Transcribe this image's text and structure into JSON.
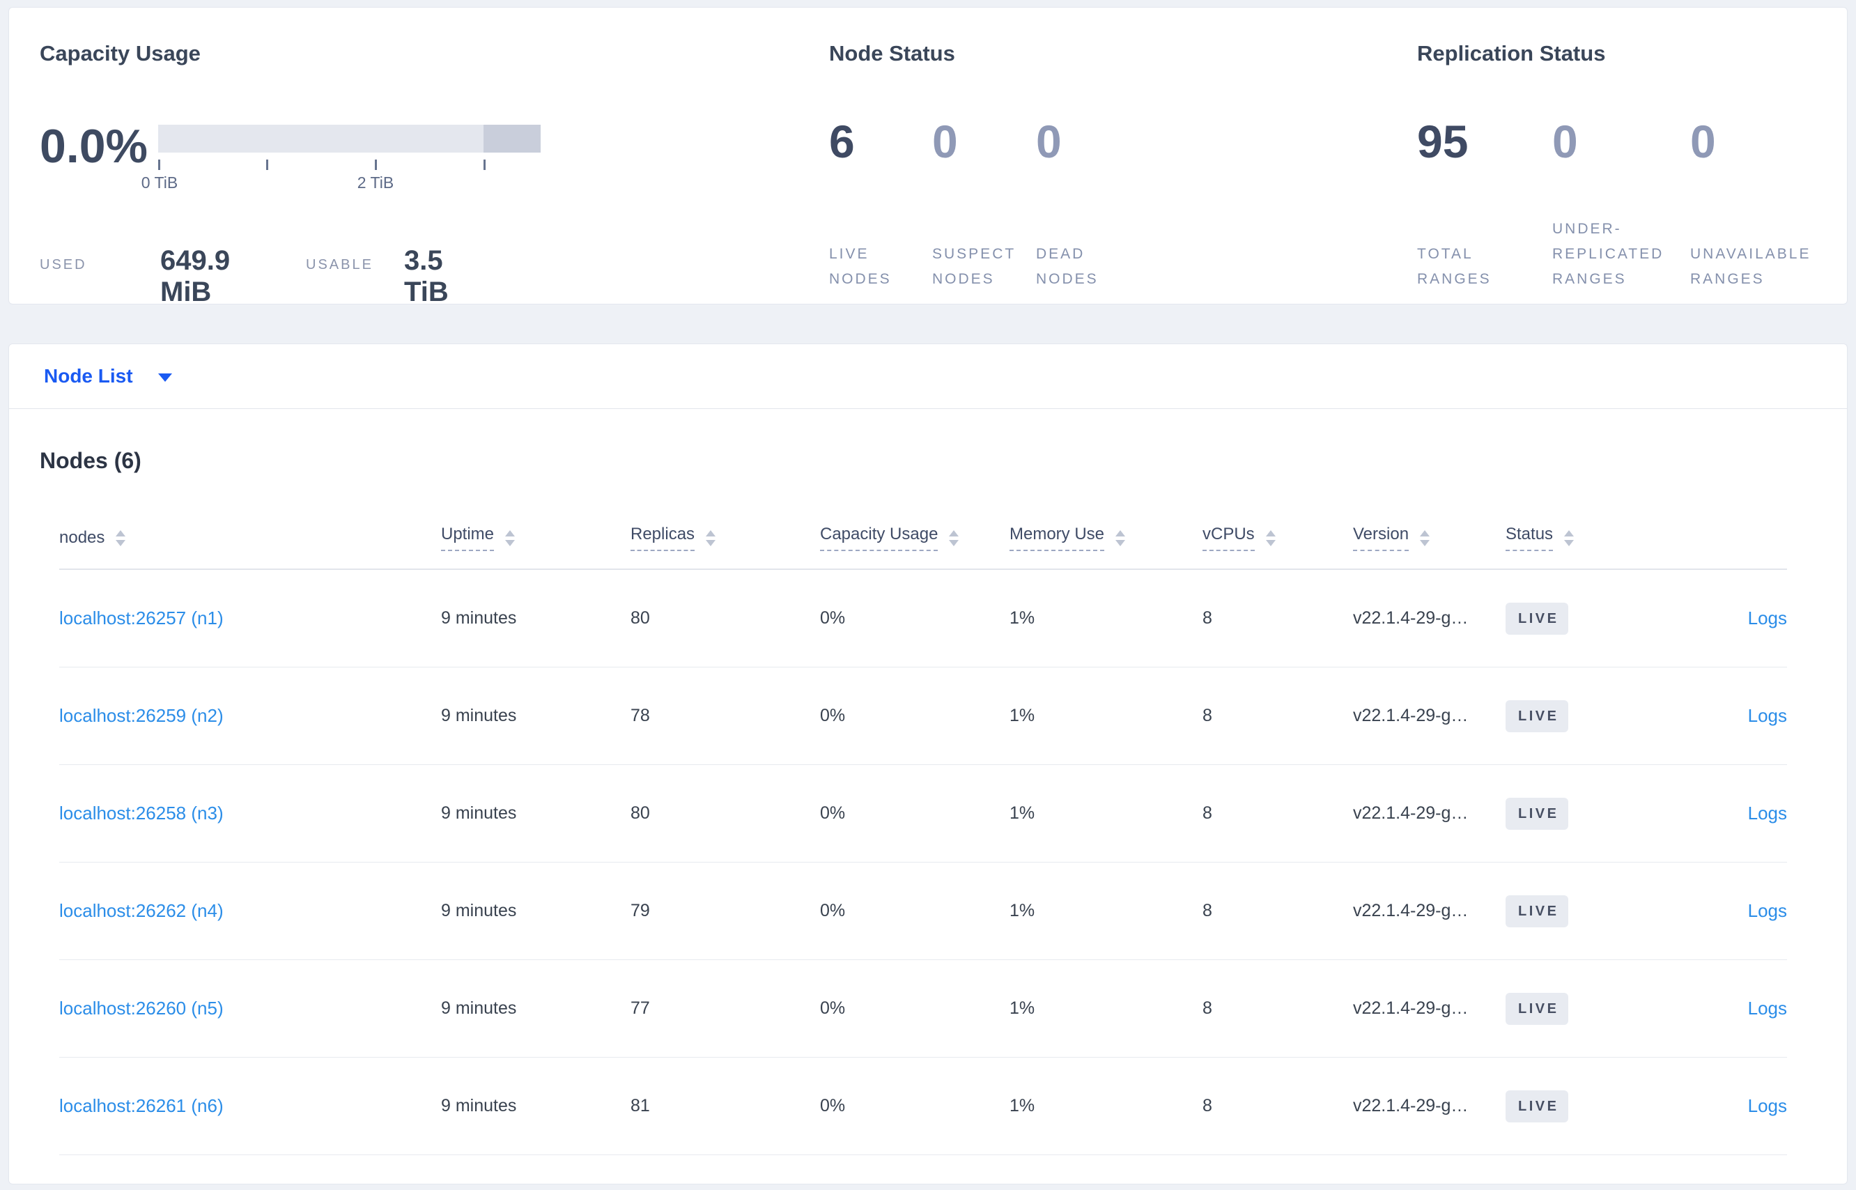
{
  "summary": {
    "capacity": {
      "title": "Capacity Usage",
      "percent": "0.0%",
      "tick_labels": [
        "0 TiB",
        "2 TiB"
      ],
      "used_label": "USED",
      "used_value": "649.9 MiB",
      "usable_label": "USABLE",
      "usable_value": "3.5 TiB"
    },
    "node_status": {
      "title": "Node Status",
      "stats": [
        {
          "value": "6",
          "label": "LIVE\nNODES"
        },
        {
          "value": "0",
          "label": "SUSPECT\nNODES"
        },
        {
          "value": "0",
          "label": "DEAD\nNODES"
        }
      ]
    },
    "replication": {
      "title": "Replication Status",
      "stats": [
        {
          "value": "95",
          "label": "TOTAL\nRANGES"
        },
        {
          "value": "0",
          "label": "UNDER-\nREPLICATED\nRANGES"
        },
        {
          "value": "0",
          "label": "UNAVAILABLE\nRANGES"
        }
      ]
    }
  },
  "view_selector": {
    "label": "Node List"
  },
  "nodes_table": {
    "section_title": "Nodes (6)",
    "columns": [
      "nodes",
      "Uptime",
      "Replicas",
      "Capacity Usage",
      "Memory Use",
      "vCPUs",
      "Version",
      "Status"
    ],
    "rows": [
      {
        "node": "localhost:26257 (n1)",
        "uptime": "9 minutes",
        "replicas": "80",
        "capacity_usage": "0%",
        "memory_use": "1%",
        "vcpus": "8",
        "version": "v22.1.4-29-g…",
        "status": "LIVE",
        "logs": "Logs"
      },
      {
        "node": "localhost:26259 (n2)",
        "uptime": "9 minutes",
        "replicas": "78",
        "capacity_usage": "0%",
        "memory_use": "1%",
        "vcpus": "8",
        "version": "v22.1.4-29-g…",
        "status": "LIVE",
        "logs": "Logs"
      },
      {
        "node": "localhost:26258 (n3)",
        "uptime": "9 minutes",
        "replicas": "80",
        "capacity_usage": "0%",
        "memory_use": "1%",
        "vcpus": "8",
        "version": "v22.1.4-29-g…",
        "status": "LIVE",
        "logs": "Logs"
      },
      {
        "node": "localhost:26262 (n4)",
        "uptime": "9 minutes",
        "replicas": "79",
        "capacity_usage": "0%",
        "memory_use": "1%",
        "vcpus": "8",
        "version": "v22.1.4-29-g…",
        "status": "LIVE",
        "logs": "Logs"
      },
      {
        "node": "localhost:26260 (n5)",
        "uptime": "9 minutes",
        "replicas": "77",
        "capacity_usage": "0%",
        "memory_use": "1%",
        "vcpus": "8",
        "version": "v22.1.4-29-g…",
        "status": "LIVE",
        "logs": "Logs"
      },
      {
        "node": "localhost:26261 (n6)",
        "uptime": "9 minutes",
        "replicas": "81",
        "capacity_usage": "0%",
        "memory_use": "1%",
        "vcpus": "8",
        "version": "v22.1.4-29-g…",
        "status": "LIVE",
        "logs": "Logs"
      }
    ]
  },
  "colors": {
    "selector_blue": "#1a5af2",
    "link_blue": "#2b8de8",
    "badge_bg": "#e8ebf1",
    "bar_track": "#e4e7ee",
    "bar_tail": "#c9cedb",
    "page_bg": "#eef1f6"
  }
}
